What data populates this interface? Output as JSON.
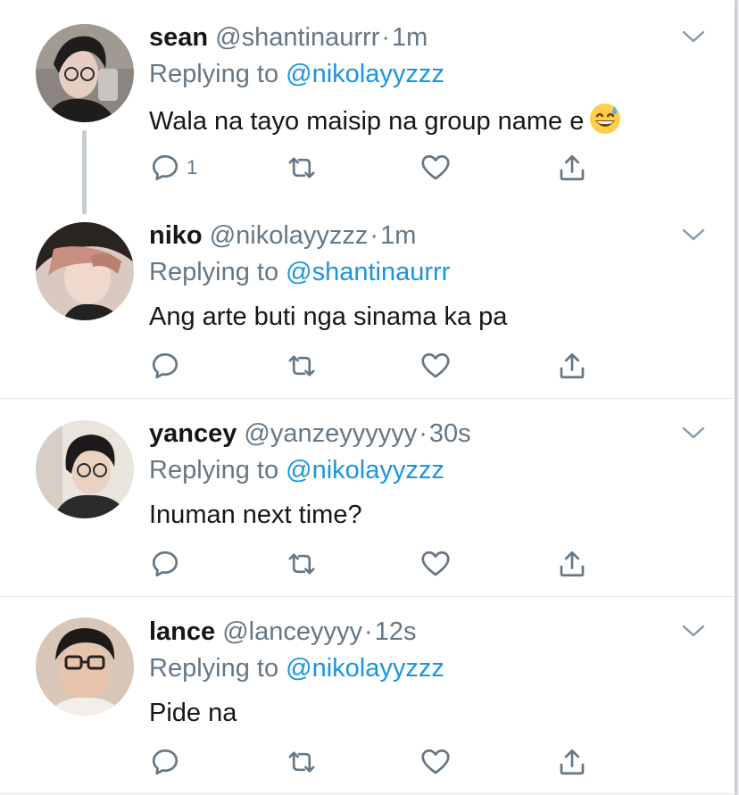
{
  "tweets": [
    {
      "name": "sean",
      "handle": "@shantinaurrr",
      "dot": "·",
      "time": "1m",
      "reply_prefix": "Replying to",
      "reply_to": "@nikolayyzzz",
      "text": "Wala na tayo maisip na group name e",
      "emoji": "grinning-face-with-sweat",
      "reply_count": "1"
    },
    {
      "name": "niko",
      "handle": "@nikolayyzzz",
      "dot": "·",
      "time": "1m",
      "reply_prefix": "Replying to",
      "reply_to": "@shantinaurrr",
      "text": "Ang arte buti nga sinama ka pa",
      "reply_count": ""
    },
    {
      "name": "yancey",
      "handle": "@yanzeyyyyyy",
      "dot": "·",
      "time": "30s",
      "reply_prefix": "Replying to",
      "reply_to": "@nikolayyzzz",
      "text": "Inuman next time?",
      "reply_count": ""
    },
    {
      "name": "lance",
      "handle": "@lanceyyyy",
      "dot": "·",
      "time": "12s",
      "reply_prefix": "Replying to",
      "reply_to": "@nikolayyzzz",
      "text": "Pide na",
      "reply_count": ""
    }
  ],
  "icons": {
    "reply": "reply-icon",
    "retweet": "retweet-icon",
    "like": "heart-icon",
    "share": "share-icon",
    "menu": "chevron-down-icon"
  },
  "colors": {
    "text": "#14171a",
    "secondary": "#657786",
    "link": "#1b95e0",
    "divider": "#e1e8ed"
  }
}
